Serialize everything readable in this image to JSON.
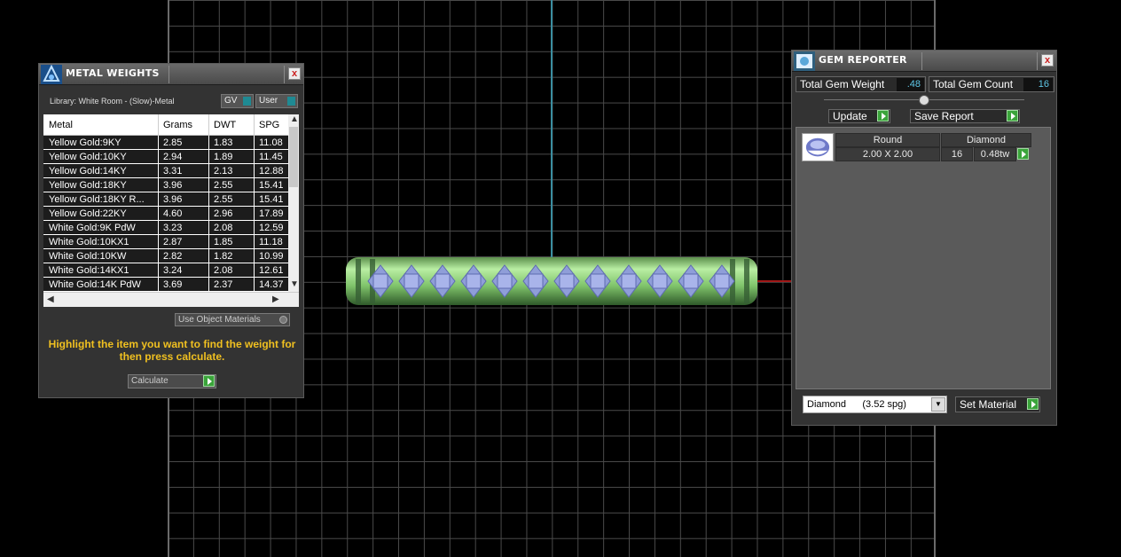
{
  "metal_window": {
    "title": "METAL WEIGHTS",
    "close_label": "x",
    "library_label": "Library: White Room - (Slow)-Metal",
    "gv_label": "GV",
    "user_label": "User",
    "columns": [
      "Metal",
      "Grams",
      "DWT",
      "SPG"
    ],
    "rows": [
      [
        "Yellow Gold:9KY",
        "2.85",
        "1.83",
        "11.08"
      ],
      [
        "Yellow Gold:10KY",
        "2.94",
        "1.89",
        "11.45"
      ],
      [
        "Yellow Gold:14KY",
        "3.31",
        "2.13",
        "12.88"
      ],
      [
        "Yellow Gold:18KY",
        "3.96",
        "2.55",
        "15.41"
      ],
      [
        "Yellow Gold:18KY R...",
        "3.96",
        "2.55",
        "15.41"
      ],
      [
        "Yellow Gold:22KY",
        "4.60",
        "2.96",
        "17.89"
      ],
      [
        "White Gold:9K PdW",
        "3.23",
        "2.08",
        "12.59"
      ],
      [
        "White Gold:10KX1",
        "2.87",
        "1.85",
        "11.18"
      ],
      [
        "White Gold:10KW",
        "2.82",
        "1.82",
        "10.99"
      ],
      [
        "White Gold:14KX1",
        "3.24",
        "2.08",
        "12.61"
      ],
      [
        "White Gold:14K PdW",
        "3.69",
        "2.37",
        "14.37"
      ]
    ],
    "use_object_materials": "Use Object Materials",
    "hint": "Highlight the item you want to find the weight for then press calculate.",
    "calculate_label": "Calculate"
  },
  "gem_window": {
    "title": "GEM REPORTER",
    "close_label": "x",
    "total_gem_weight_label": "Total Gem Weight",
    "total_gem_weight_value": ".48",
    "total_gem_count_label": "Total Gem Count",
    "total_gem_count_value": "16",
    "update_label": "Update",
    "save_report_label": "Save Report",
    "gem": {
      "shape": "Round",
      "material": "Diamond",
      "size": "2.00 X 2.00",
      "count": "16",
      "weight": "0.48tw"
    },
    "material_select": "Diamond      (3.52 spg)",
    "set_material_label": "Set Material"
  },
  "colors": {
    "hint_text": "#f0c020",
    "value_text": "#5fc8e8",
    "play_green": "#3aa43a",
    "axis_y": "#3a8da0",
    "axis_x": "#a11818"
  }
}
